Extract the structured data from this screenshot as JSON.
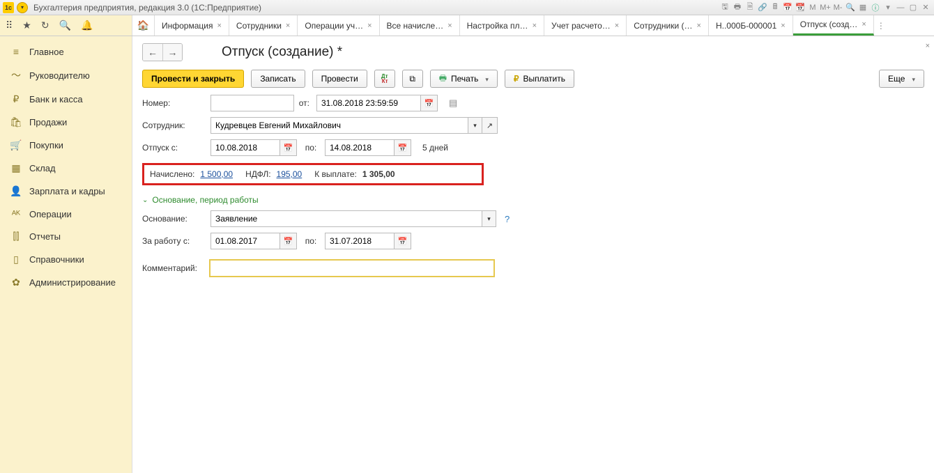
{
  "app": {
    "title": "Бухгалтерия предприятия, редакция 3.0  (1С:Предприятие)",
    "logo_text": "1с"
  },
  "win_icons": {
    "m": "M",
    "mp": "M+",
    "mm": "M-"
  },
  "tabs": [
    {
      "label": "Информация"
    },
    {
      "label": "Сотрудники"
    },
    {
      "label": "Операции уч…"
    },
    {
      "label": "Все начисле…"
    },
    {
      "label": "Настройка пл…"
    },
    {
      "label": "Учет расчето…"
    },
    {
      "label": "Сотрудники (…"
    },
    {
      "label": "Н..000Б-000001"
    },
    {
      "label": "Отпуск (созд…",
      "active": true
    }
  ],
  "sidebar": [
    {
      "icon": "≡",
      "label": "Главное"
    },
    {
      "icon": "〜",
      "label": "Руководителю"
    },
    {
      "icon": "₽",
      "label": "Банк и касса"
    },
    {
      "icon": "🛍",
      "label": "Продажи"
    },
    {
      "icon": "🛒",
      "label": "Покупки"
    },
    {
      "icon": "▦",
      "label": "Склад"
    },
    {
      "icon": "👤",
      "label": "Зарплата и кадры"
    },
    {
      "icon": "ᴬᴷ",
      "label": "Операции"
    },
    {
      "icon": "⫿⫿",
      "label": "Отчеты"
    },
    {
      "icon": "▯",
      "label": "Справочники"
    },
    {
      "icon": "✿",
      "label": "Администрирование"
    }
  ],
  "page": {
    "title": "Отпуск (создание) *"
  },
  "toolbar": {
    "post_close": "Провести и закрыть",
    "save": "Записать",
    "post": "Провести",
    "print": "Печать",
    "pay": "Выплатить",
    "more": "Еще"
  },
  "form": {
    "number_label": "Номер:",
    "number_value": "",
    "from_label": "от:",
    "from_value": "31.08.2018 23:59:59",
    "employee_label": "Сотрудник:",
    "employee_value": "Кудревцев Евгений Михайлович",
    "vac_from_label": "Отпуск с:",
    "vac_from_value": "10.08.2018",
    "to_label": "по:",
    "vac_to_value": "14.08.2018",
    "days_text": "5 дней",
    "accrued_label": "Начислено:",
    "accrued_value": "1 500,00",
    "ndfl_label": "НДФЛ:",
    "ndfl_value": "195,00",
    "payout_label": "К выплате:",
    "payout_value": "1 305,00",
    "section_title": "Основание, период работы",
    "basis_label": "Основание:",
    "basis_value": "Заявление",
    "work_from_label": "За работу с:",
    "work_from_value": "01.08.2017",
    "work_to_value": "31.07.2018",
    "comment_label": "Комментарий:",
    "comment_value": ""
  }
}
